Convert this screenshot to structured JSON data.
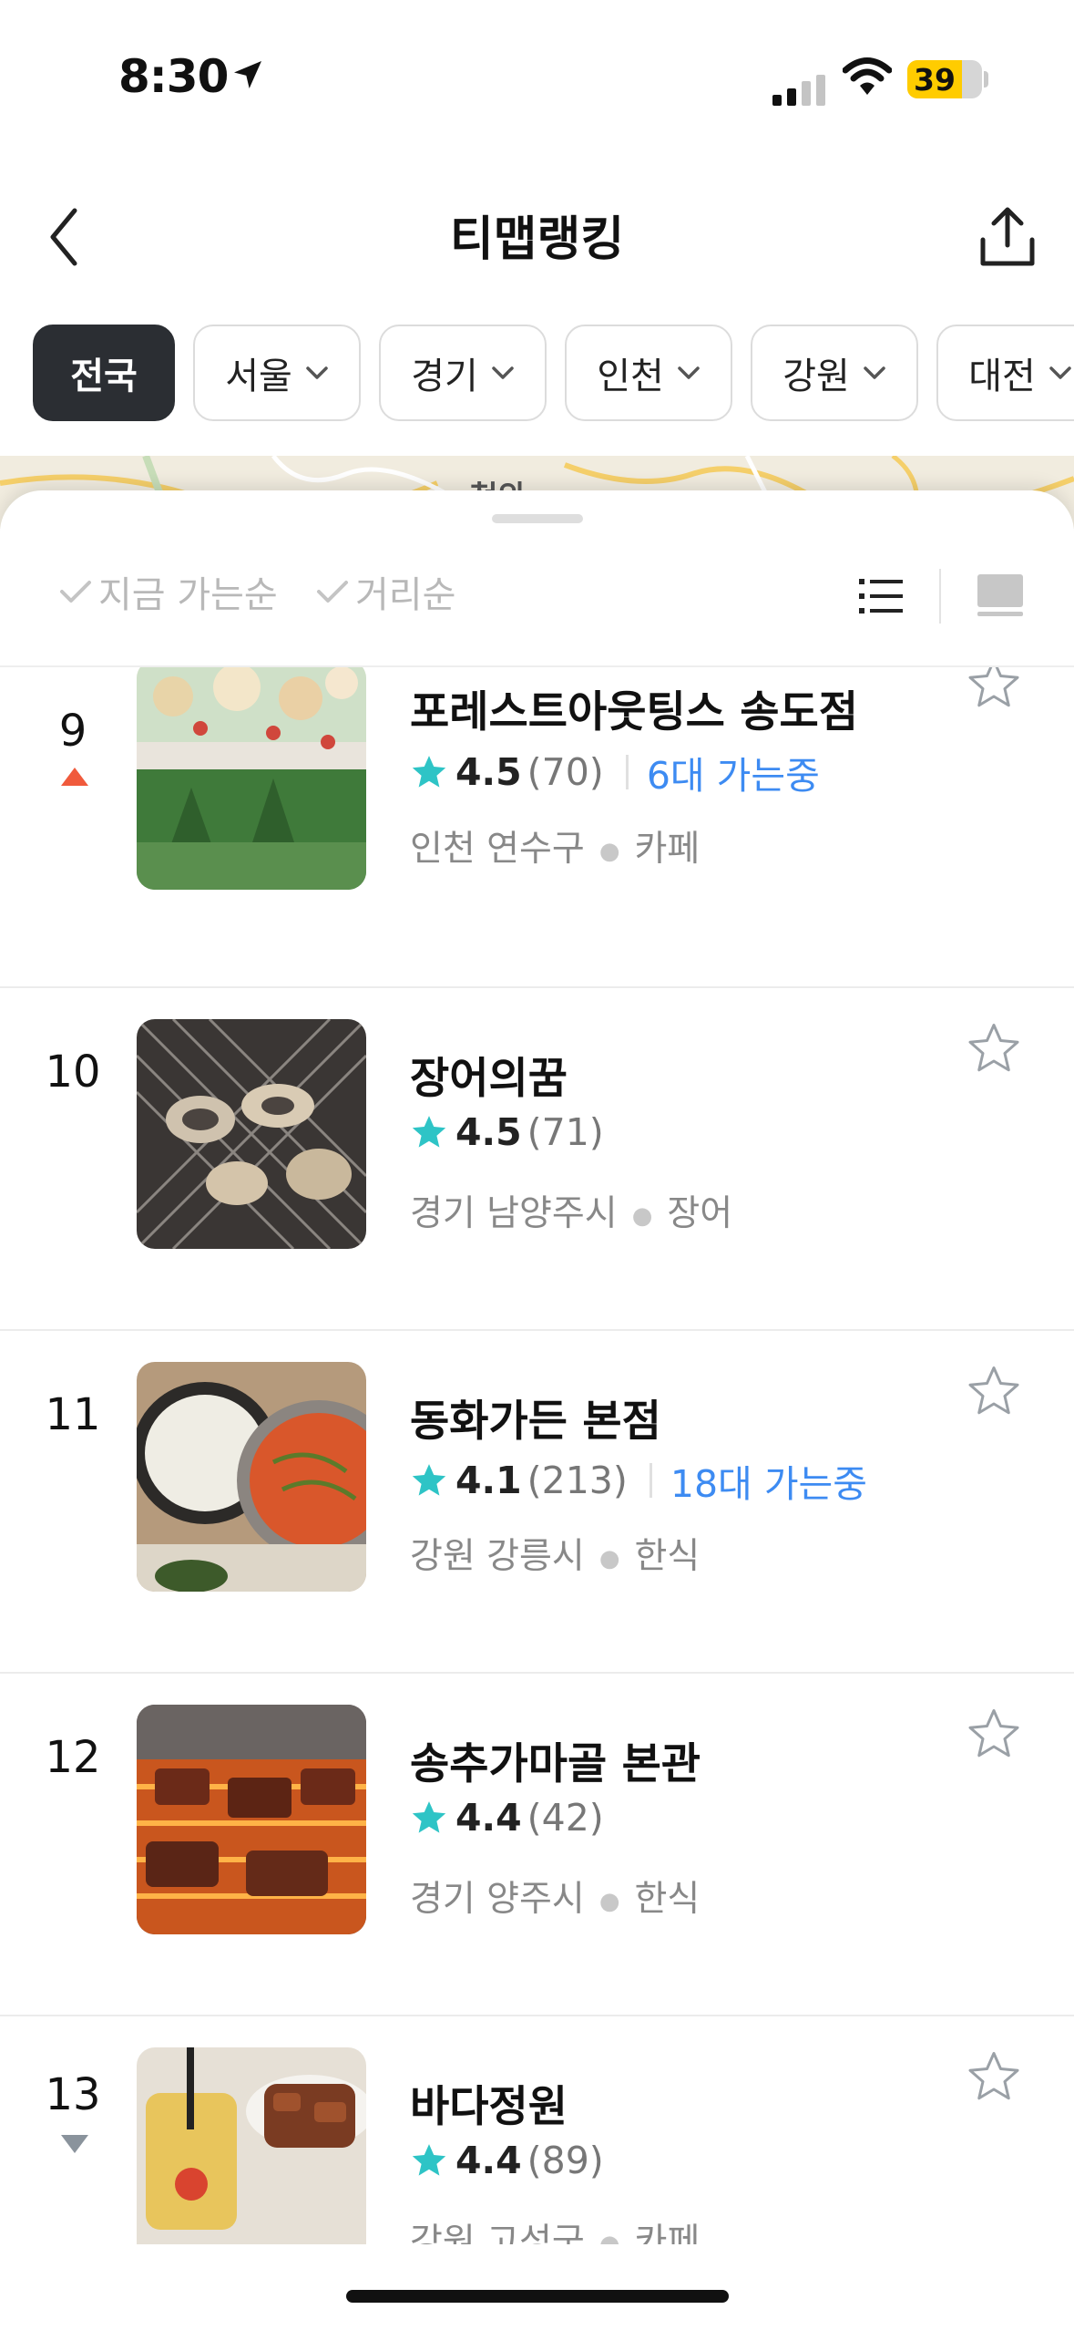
{
  "status_bar": {
    "time": "8:30",
    "battery": "39",
    "battery_level_percent": 39
  },
  "nav": {
    "title": "티맵랭킹"
  },
  "regions": [
    {
      "label": "전국",
      "active": true
    },
    {
      "label": "서울"
    },
    {
      "label": "경기"
    },
    {
      "label": "인천"
    },
    {
      "label": "강원"
    },
    {
      "label": "대전"
    }
  ],
  "map": {
    "label": "o청와"
  },
  "sort": {
    "now_going": "지금 가는순",
    "distance": "거리순"
  },
  "colors": {
    "accent_blue": "#3d8bf2",
    "star_teal": "#2ec4c6",
    "rank_up": "#f05a3c",
    "rank_down": "#8a939c"
  },
  "items": [
    {
      "rank": "9",
      "trend": "up",
      "name": "포레스트아웃팅스 송도점",
      "score": "4.5",
      "count": "(70)",
      "live": "6대 가는중",
      "area": "인천 연수구",
      "category": "카페"
    },
    {
      "rank": "10",
      "trend": "",
      "name": "장어의꿈",
      "score": "4.5",
      "count": "(71)",
      "live": "",
      "area": "경기 남양주시",
      "category": "장어"
    },
    {
      "rank": "11",
      "trend": "",
      "name": "동화가든 본점",
      "score": "4.1",
      "count": "(213)",
      "live": "18대 가는중",
      "area": "강원 강릉시",
      "category": "한식"
    },
    {
      "rank": "12",
      "trend": "",
      "name": "송추가마골 본관",
      "score": "4.4",
      "count": "(42)",
      "live": "",
      "area": "경기 양주시",
      "category": "한식"
    },
    {
      "rank": "13",
      "trend": "down",
      "name": "바다정원",
      "score": "4.4",
      "count": "(89)",
      "live": "",
      "area": "강원 고성군",
      "category": "카페"
    }
  ]
}
